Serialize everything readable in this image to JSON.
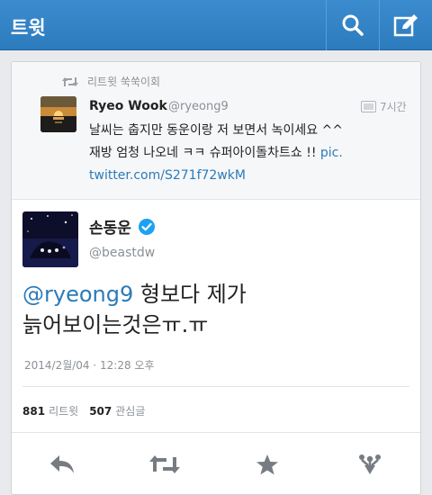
{
  "header": {
    "title": "트윗",
    "search_icon": "search-icon",
    "compose_icon": "compose-icon"
  },
  "quoted": {
    "retweet_label": "리트윗 쑥쑥이회",
    "name": "Ryeo Wook",
    "handle": "@ryeong9",
    "time": "7시간",
    "text_line1": "날씨는 춥지만 동운이랑 저 보면서 녹이세요 ^^",
    "text_line2": "재방 엄청 나오네 ㅋㅋ 슈퍼아이돌차트쇼 !! ",
    "link_part1": "pic.",
    "link_part2": "twitter.com/S271f72wkM"
  },
  "tweet": {
    "name": "손동운",
    "handle": "@beastdw",
    "mention": "@ryeong9",
    "text_after_mention": " 형보다 제가",
    "text_line2": "늙어보이는것은ㅠ.ㅠ",
    "timestamp": "2014/2월/04 · 12:28 오후",
    "retweet_count": "881",
    "retweet_count_label": "리트윗",
    "fav_count": "507",
    "fav_count_label": "관심글"
  },
  "colors": {
    "header_blue": "#2c7bbd",
    "link_blue": "#2b7bb9",
    "verified_blue": "#1da1f2",
    "muted": "#8b9096"
  }
}
